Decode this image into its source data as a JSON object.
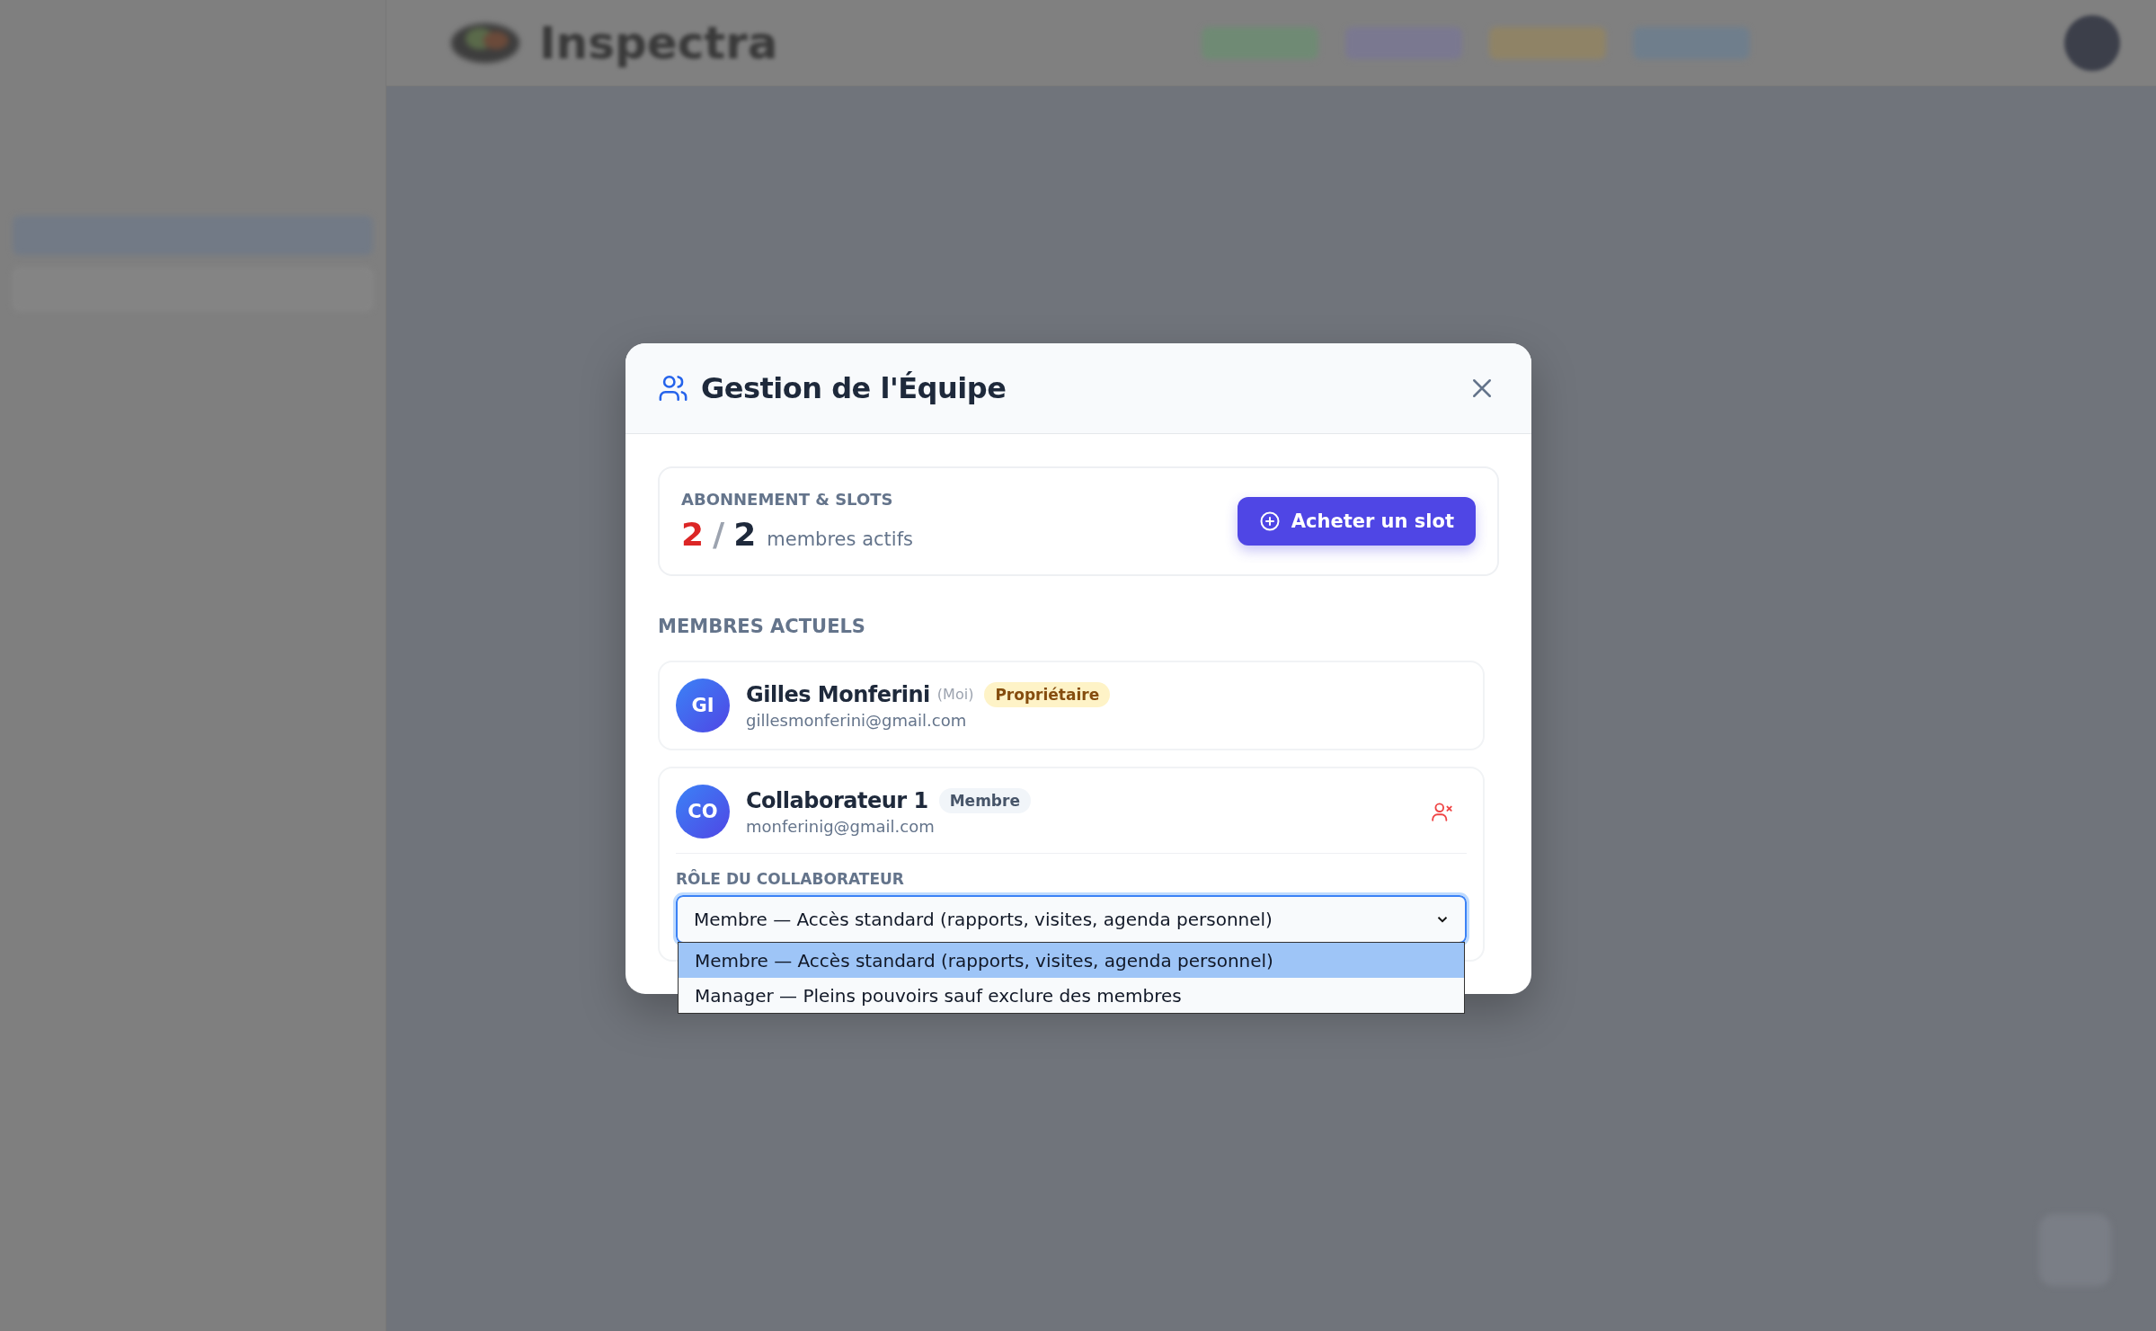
{
  "app": {
    "name": "Inspectra"
  },
  "dialog": {
    "title": "Gestion de l'Équipe",
    "subscription": {
      "label": "ABONNEMENT & SLOTS",
      "used": "2",
      "separator": "/",
      "total": "2",
      "caption": "membres actifs",
      "button": "Acheter un slot"
    },
    "members_heading": "MEMBRES ACTUELS",
    "members": [
      {
        "initials": "GI",
        "name": "Gilles Monferini",
        "self_tag": "(Moi)",
        "role_badge": "Propriétaire",
        "kind": "owner",
        "email": "gillesmonferini@gmail.com",
        "removable": false
      },
      {
        "initials": "CO",
        "name": "Collaborateur 1",
        "role_badge": "Membre",
        "kind": "member",
        "email": "monferinig@gmail.com",
        "removable": true,
        "role_select": {
          "label": "RÔLE DU COLLABORATEUR",
          "value": "Membre — Accès standard (rapports, visites, agenda personnel)",
          "expanded": true,
          "options": [
            {
              "label": "Membre — Accès standard (rapports, visites, agenda personnel)",
              "selected": true
            },
            {
              "label": "Manager — Pleins pouvoirs sauf exclure des membres",
              "selected": false
            }
          ]
        }
      }
    ]
  }
}
